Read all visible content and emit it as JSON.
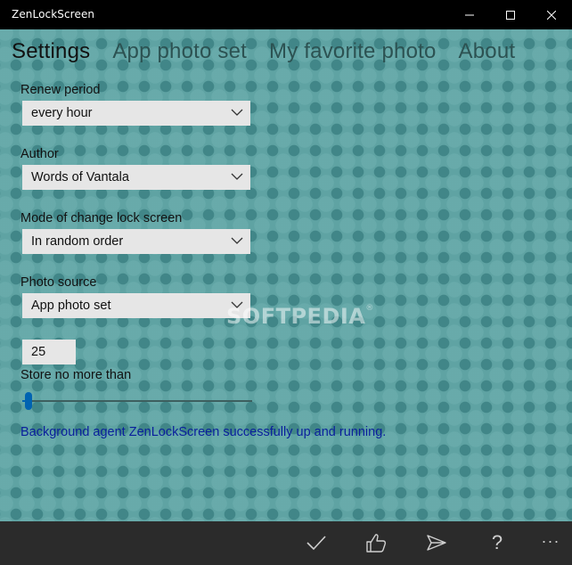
{
  "window": {
    "title": "ZenLockScreen",
    "controls": {
      "minimize_icon": "minimize-icon",
      "maximize_icon": "maximize-icon",
      "close_icon": "close-icon"
    }
  },
  "tabs": [
    {
      "label": "Settings",
      "active": true
    },
    {
      "label": "App photo set",
      "active": false
    },
    {
      "label": "My favorite photo",
      "active": false
    },
    {
      "label": "About",
      "active": false
    }
  ],
  "settings": {
    "renew_period": {
      "label": "Renew period",
      "value": "every hour"
    },
    "author": {
      "label": "Author",
      "value": "Words of Vantala"
    },
    "mode": {
      "label": "Mode of  change lock screen",
      "value": "In random order"
    },
    "photo_source": {
      "label": "Photo source",
      "value": "App photo set"
    },
    "store_limit": {
      "label": "Store no more than",
      "value": "25",
      "slider_fraction": 0.01
    }
  },
  "status": {
    "text": "Background agent ZenLockScreen successfully up and running."
  },
  "watermark": {
    "text": "SOFTPEDIA",
    "mark": "®"
  },
  "appbar": {
    "accept_icon": "checkmark-icon",
    "like_icon": "thumbs-up-icon",
    "send_icon": "send-icon",
    "help_glyph": "?",
    "more_glyph": "···"
  },
  "colors": {
    "background": "#5fa3a3",
    "titlebar": "#000000",
    "appbar": "#2b2b2b",
    "accent": "#0063b1",
    "status_text": "#0a1f9c"
  }
}
